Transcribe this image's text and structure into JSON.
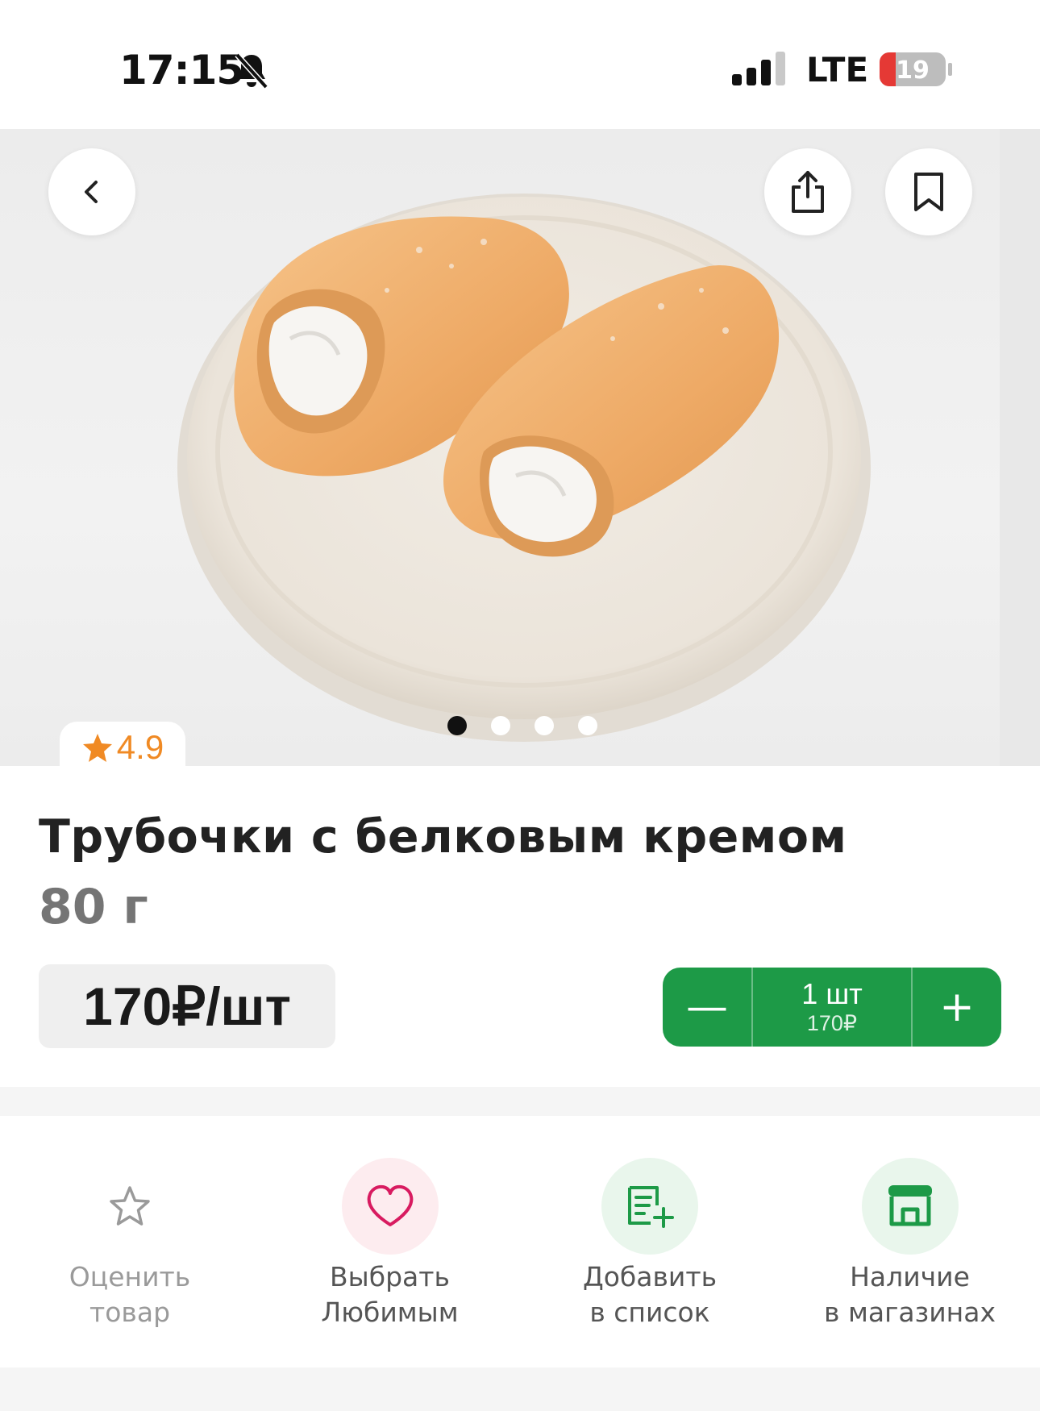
{
  "status_bar": {
    "time": "17:15",
    "network": "LTE",
    "battery": "19"
  },
  "gallery": {
    "slides_total": 4,
    "active_slide": 1
  },
  "rating": {
    "value": "4.9",
    "color": "#f08a24"
  },
  "product": {
    "title": "Трубочки с белковым кремом",
    "weight": "80 г",
    "price": "170₽/шт"
  },
  "stepper": {
    "minus": "—",
    "plus": "+",
    "quantity": "1 шт",
    "sum": "170₽",
    "color": "#1d9a47"
  },
  "actions": [
    {
      "line1": "Оценить",
      "line2": "товар",
      "icon": "star-outline-icon"
    },
    {
      "line1": "Выбрать",
      "line2": "Любимым",
      "icon": "heart-icon"
    },
    {
      "line1": "Добавить",
      "line2": "в список",
      "icon": "add-to-list-icon"
    },
    {
      "line1": "Наличие",
      "line2": "в магазинах",
      "icon": "store-icon"
    }
  ]
}
